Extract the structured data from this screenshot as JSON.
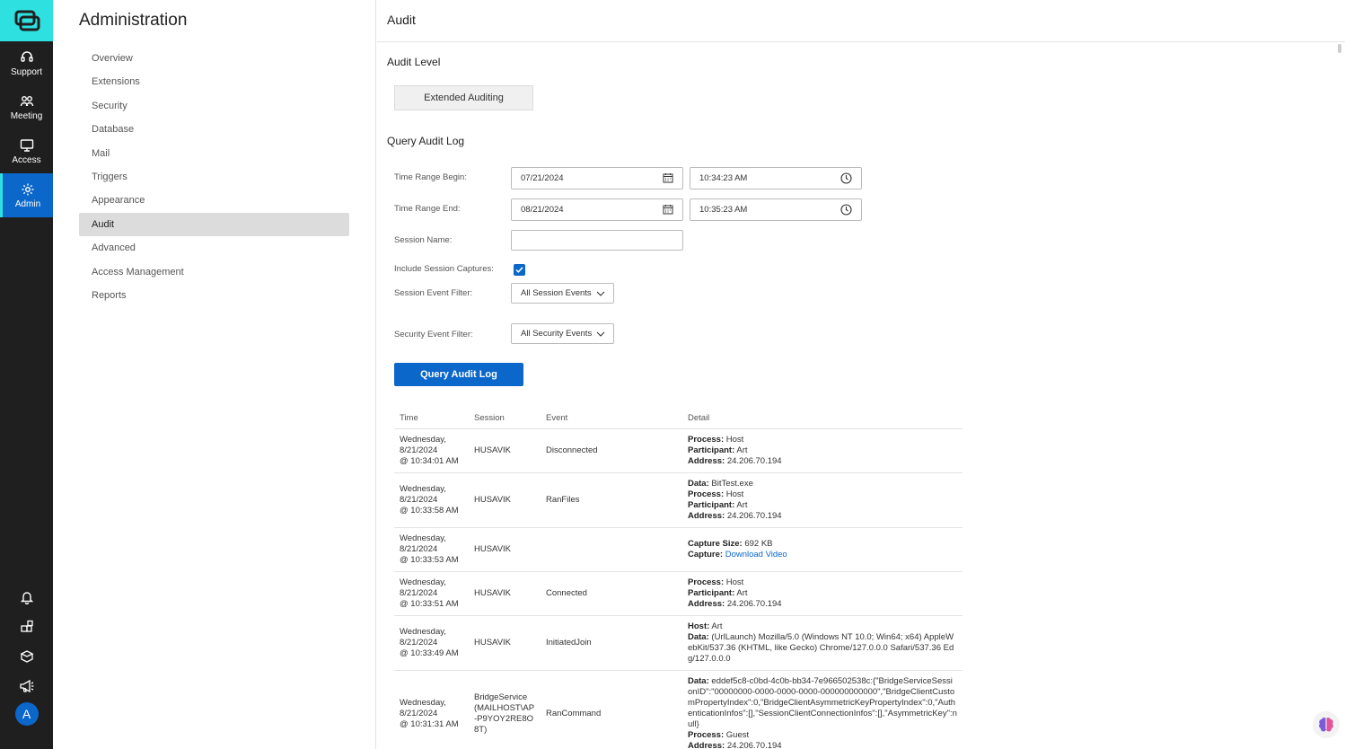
{
  "rail": {
    "items": [
      {
        "label": "Support",
        "icon": "headset-icon"
      },
      {
        "label": "Meeting",
        "icon": "people-icon"
      },
      {
        "label": "Access",
        "icon": "monitor-icon"
      },
      {
        "label": "Admin",
        "icon": "gear-icon"
      }
    ],
    "avatar_letter": "A"
  },
  "admin": {
    "title": "Administration",
    "nav": [
      "Overview",
      "Extensions",
      "Security",
      "Database",
      "Mail",
      "Triggers",
      "Appearance",
      "Audit",
      "Advanced",
      "Access Management",
      "Reports"
    ],
    "active": "Audit"
  },
  "main": {
    "header": "Audit",
    "audit_level": {
      "title": "Audit Level",
      "button": "Extended Auditing"
    },
    "query": {
      "title": "Query Audit Log",
      "begin_label": "Time Range Begin:",
      "begin_date": "07/21/2024",
      "begin_time": "10:34:23 AM",
      "end_label": "Time Range End:",
      "end_date": "08/21/2024",
      "end_time": "10:35:23 AM",
      "session_label": "Session Name:",
      "session_value": "",
      "captures_label": "Include Session Captures:",
      "captures_checked": true,
      "session_filter_label": "Session Event Filter:",
      "session_filter_value": "All Session Events",
      "security_filter_label": "Security Event Filter:",
      "security_filter_value": "All Security Events",
      "submit": "Query Audit Log"
    },
    "table": {
      "headers": [
        "Time",
        "Session",
        "Event",
        "Detail"
      ],
      "rows": [
        {
          "time": [
            "Wednesday,",
            "8/21/2024",
            "@ 10:34:01 AM"
          ],
          "session": "HUSAVIK",
          "event": "Disconnected",
          "detail": [
            {
              "k": "Process:",
              "v": "Host"
            },
            {
              "k": "Participant:",
              "v": "Art"
            },
            {
              "k": "Address:",
              "v": "24.206.70.194"
            }
          ]
        },
        {
          "time": [
            "Wednesday,",
            "8/21/2024",
            "@ 10:33:58 AM"
          ],
          "session": "HUSAVIK",
          "event": "RanFiles",
          "detail": [
            {
              "k": "Data:",
              "v": "BitTest.exe"
            },
            {
              "k": "Process:",
              "v": "Host"
            },
            {
              "k": "Participant:",
              "v": "Art"
            },
            {
              "k": "Address:",
              "v": "24.206.70.194"
            }
          ]
        },
        {
          "time": [
            "Wednesday,",
            "8/21/2024",
            "@ 10:33:53 AM"
          ],
          "session": "HUSAVIK",
          "event": "",
          "detail": [
            {
              "k": "Capture Size:",
              "v": "692 KB"
            },
            {
              "k": "Capture:",
              "v": "Download Video",
              "link": true
            }
          ]
        },
        {
          "time": [
            "Wednesday,",
            "8/21/2024",
            "@ 10:33:51 AM"
          ],
          "session": "HUSAVIK",
          "event": "Connected",
          "detail": [
            {
              "k": "Process:",
              "v": "Host"
            },
            {
              "k": "Participant:",
              "v": "Art"
            },
            {
              "k": "Address:",
              "v": "24.206.70.194"
            }
          ]
        },
        {
          "time": [
            "Wednesday,",
            "8/21/2024",
            "@ 10:33:49 AM"
          ],
          "session": "HUSAVIK",
          "event": "InitiatedJoin",
          "detail": [
            {
              "k": "Host:",
              "v": "Art"
            },
            {
              "k": "Data:",
              "v": "(UrlLaunch) Mozilla/5.0 (Windows NT 10.0; Win64; x64) AppleWebKit/537.36 (KHTML, like Gecko) Chrome/127.0.0.0 Safari/537.36 Edg/127.0.0.0"
            }
          ]
        },
        {
          "time": [
            "Wednesday,",
            "8/21/2024",
            "@ 10:31:31 AM"
          ],
          "session": "BridgeService (MAILHOST\\AP-P9YOY2RE8O8T)",
          "event": "RanCommand",
          "detail": [
            {
              "k": "Data:",
              "v": "eddef5c8-c0bd-4c0b-bb34-7e966502538c:{\"BridgeServiceSessionID\":\"00000000-0000-0000-0000-000000000000\",\"BridgeClientCustomPropertyIndex\":0,\"BridgeClientAsymmetricKeyPropertyIndex\":0,\"AuthenticationInfos\":[],\"SessionClientConnectionInfos\":[],\"AsymmetricKey\":null}"
            },
            {
              "k": "Process:",
              "v": "Guest"
            },
            {
              "k": "Address:",
              "v": "24.206.70.194"
            }
          ]
        }
      ]
    }
  }
}
